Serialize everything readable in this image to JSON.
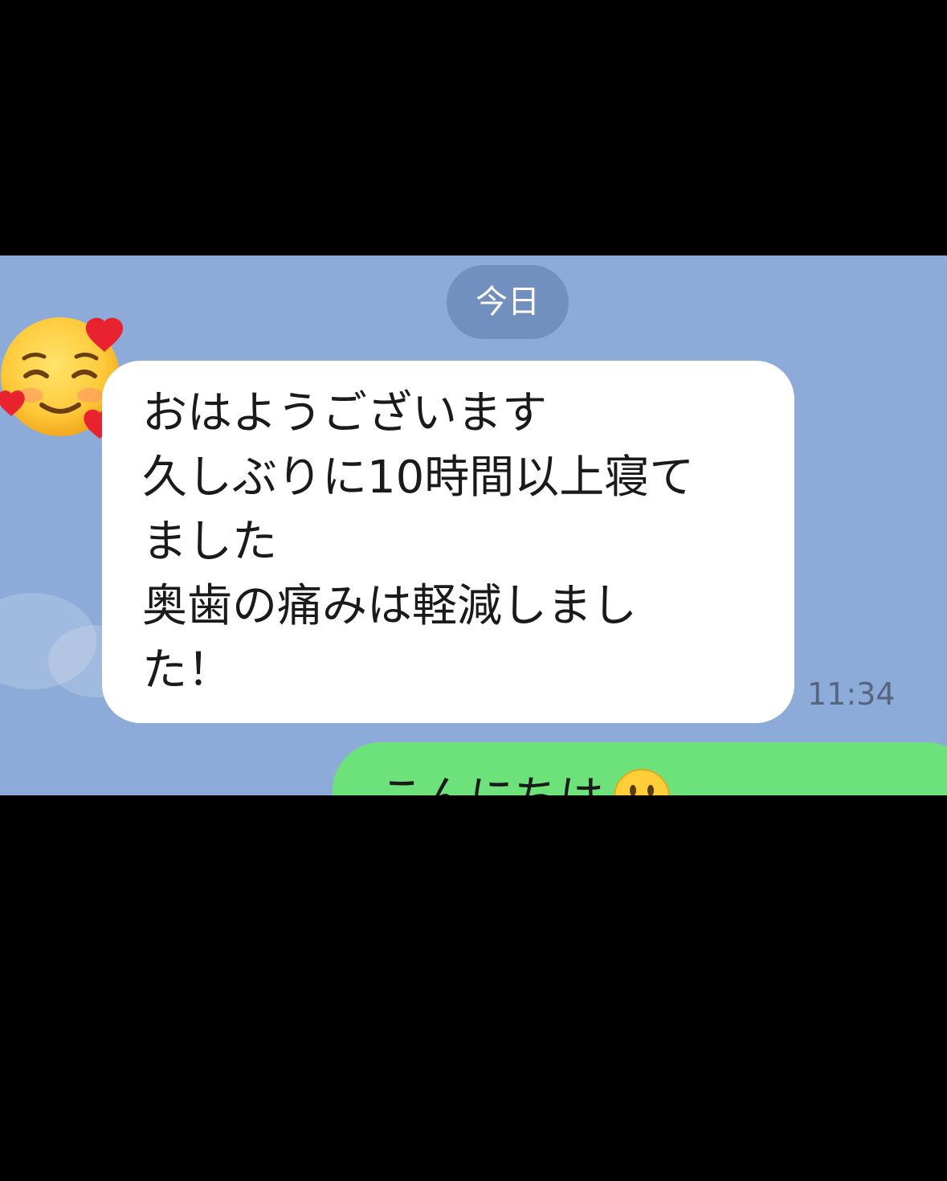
{
  "date_separator": "今日",
  "messages": [
    {
      "direction": "incoming",
      "sender_avatar": "smiling-face-with-hearts-icon",
      "text": "おはようございます\n久しぶりに10時間以上寝て\nました\n奥歯の痛みは軽減しまし\nた！",
      "time": "11:34"
    },
    {
      "direction": "outgoing",
      "text": "こんにちは",
      "emoji": "slightly-smiling-face-icon"
    }
  ],
  "colors": {
    "chat_background": "#8dabd8",
    "date_pill": "#7190bf",
    "incoming_bubble": "#ffffff",
    "outgoing_bubble": "#6de27a",
    "timestamp": "#56657d"
  }
}
